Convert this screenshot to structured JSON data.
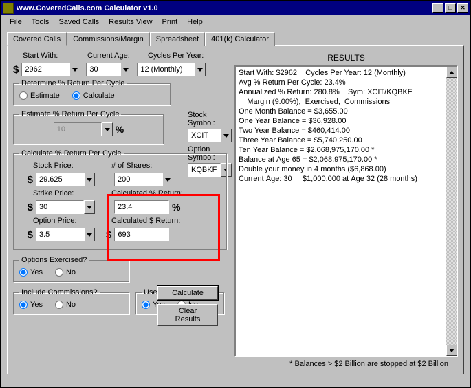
{
  "title": "www.CoveredCalls.com Calculator v1.0",
  "menu": {
    "file": "File",
    "tools": "Tools",
    "saved_calls": "Saved Calls",
    "results_view": "Results View",
    "print": "Print",
    "help": "Help"
  },
  "tabs": {
    "covered_calls": "Covered Calls",
    "commissions": "Commissions/Margin",
    "spreadsheet": "Spreadsheet",
    "k401": "401(k) Calculator"
  },
  "headings": {
    "start_with": "Start With:",
    "current_age": "Current Age:",
    "cycles_per_year": "Cycles Per Year:",
    "determine": "Determine % Return Per Cycle",
    "estimate_group": "Estimate % Return Per Cycle",
    "stock_symbol": "Stock Symbol:",
    "option_symbol": "Option Symbol:",
    "calc_group": "Calculate % Return Per Cycle",
    "stock_price": "Stock Price:",
    "shares": "# of Shares:",
    "strike_price": "Strike Price:",
    "calc_pct": "Calculated % Return:",
    "option_price": "Option Price:",
    "calc_dollar": "Calculated $ Return:",
    "options_exercised": "Options Exercised?",
    "include_comm": "Include Commissions?",
    "use_margin": "Use Margin?",
    "results": "RESULTS"
  },
  "radios": {
    "estimate": "Estimate",
    "calculate": "Calculate",
    "yes": "Yes",
    "no": "No"
  },
  "buttons": {
    "calculate": "Calculate",
    "clear": "Clear Results"
  },
  "values": {
    "start_with": "2962",
    "current_age": "30",
    "cycles": "12 (Monthly)",
    "estimate_pct": "10",
    "stock_symbol": "XCIT",
    "option_symbol": "KQBKF",
    "stock_price": "29.625",
    "shares": "200",
    "strike_price": "30",
    "calc_pct": "23.4",
    "option_price": "3.5",
    "calc_dollar": "693"
  },
  "results_lines": [
    "Start With: $2962    Cycles Per Year: 12 (Monthly)",
    "Avg % Return Per Cycle: 23.4%",
    "Annualized % Return: 280.8%    Sym: XCIT/KQBKF",
    "    Margin (9.00%),  Exercised,  Commissions",
    "One Month Balance = $3,655.00",
    "One Year Balance = $36,928.00",
    "Two Year Balance = $460,414.00",
    "Three Year Balance = $5,740,250.00",
    "Ten Year Balance = $2,068,975,170.00 *",
    "Balance at Age 65 = $2,068,975,170.00 *",
    "Double your money in 4 months ($6,868.00)",
    "Current Age: 30     $1,000,000 at Age 32 (28 months)"
  ],
  "footnote": "* Balances > $2 Billion are stopped at $2 Billion"
}
